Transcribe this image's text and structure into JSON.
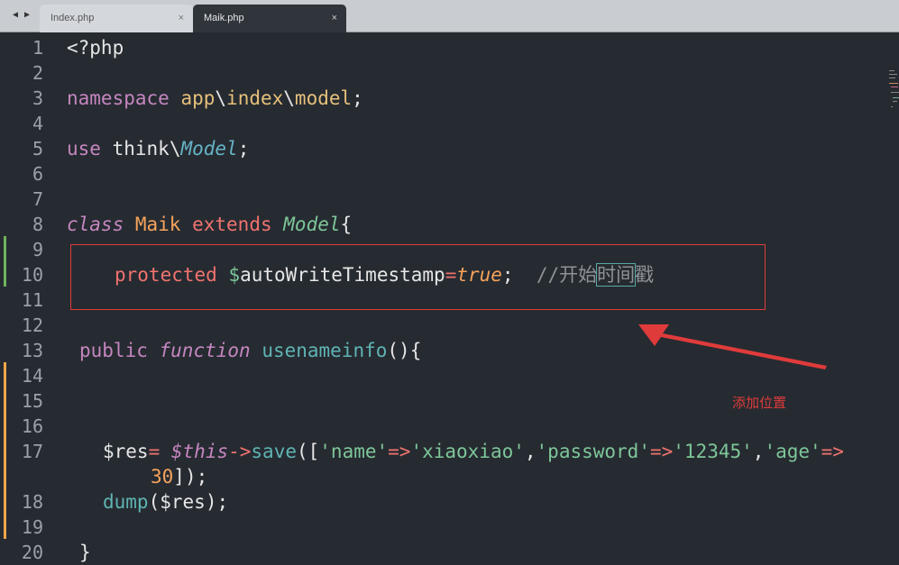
{
  "tabs": [
    {
      "label": "Index.php",
      "close": "×",
      "active": false
    },
    {
      "label": "Maik.php",
      "close": "×",
      "active": true
    }
  ],
  "nav": {
    "back": "◀",
    "forward": "▶"
  },
  "line_numbers": [
    "1",
    "2",
    "3",
    "4",
    "5",
    "6",
    "7",
    "8",
    "9",
    "10",
    "11",
    "12",
    "13",
    "14",
    "15",
    "16",
    "17",
    "18",
    "19",
    "20"
  ],
  "code": {
    "l1": "<?php",
    "l3_ns": "namespace",
    "l3_app": "app",
    "l3_sep1": "\\",
    "l3_index": "index",
    "l3_sep2": "\\",
    "l3_model": "model",
    "l3_semi": ";",
    "l5_use": "use",
    "l5_think": "think",
    "l5_sep": "\\",
    "l5_model": "Model",
    "l5_semi": ";",
    "l8_class": "class",
    "l8_name": "Maik",
    "l8_extends": "extends",
    "l8_parent": "Model",
    "l8_brace": "{",
    "l10_protected": "protected",
    "l10_dollar": "$",
    "l10_var": "autoWriteTimestamp",
    "l10_eq": "=",
    "l10_true": "true",
    "l10_semi": ";",
    "l10_comment_a": "//开始",
    "l10_comment_hl": "时间",
    "l10_comment_b": "戳",
    "l13_public": "public",
    "l13_function": "function",
    "l13_name": "usenameinfo",
    "l13_rest": "(){",
    "l17_res": "$res",
    "l17_eq": "=",
    "l17_this": "$this",
    "l17_arrow": "->",
    "l17_save": "save",
    "l17_open": "([",
    "l17_k1": "'name'",
    "l17_a1": "=>",
    "l17_v1": "'xiaoxiao'",
    "l17_c1": ",",
    "l17_k2": "'password'",
    "l17_a2": "=>",
    "l17_v2": "'12345'",
    "l17_c2": ",",
    "l17_k3": "'age'",
    "l17_a3": "=>",
    "l17_wrap_num": "30",
    "l17_wrap_close": "]);",
    "l18_dump": "dump",
    "l18_open": "(",
    "l18_res": "$res",
    "l18_close": ");",
    "l20_brace": "}"
  },
  "annotation": {
    "text": "添加位置",
    "color": "#e03b3b"
  },
  "colors": {
    "background": "#262b31",
    "tabbar": "#c9ccd1",
    "annotation": "#e03b3b",
    "gutter_change": "#f0a54a",
    "gutter_add": "#6fb35e"
  }
}
